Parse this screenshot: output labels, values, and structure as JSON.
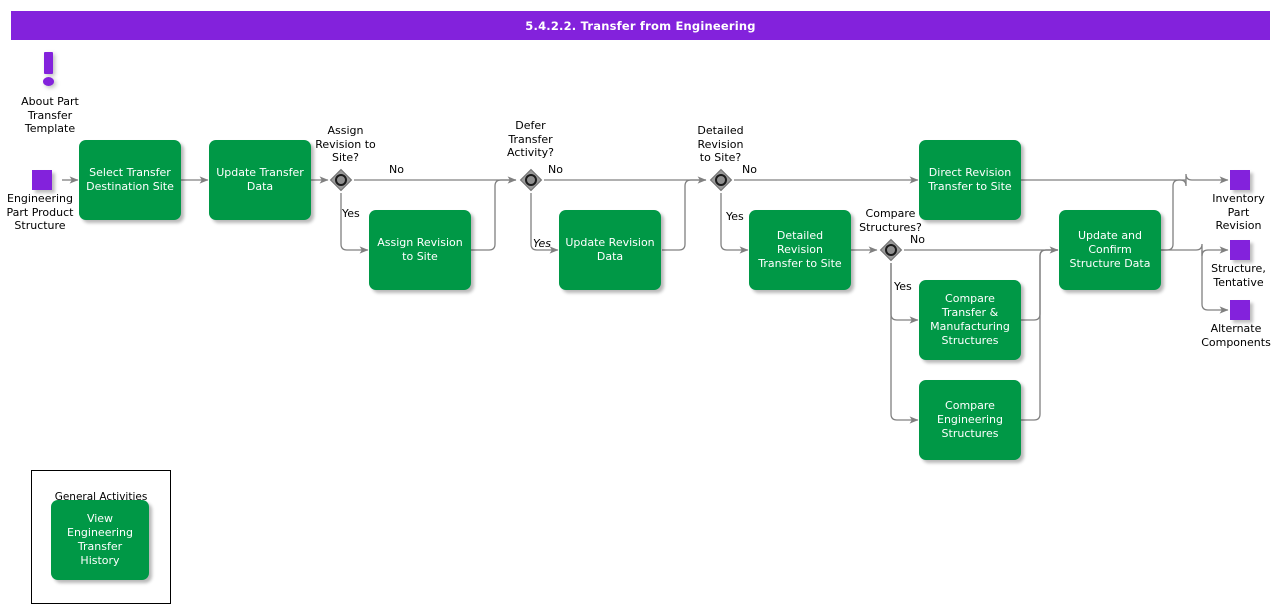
{
  "header": {
    "title": "5.4.2.2. Transfer from Engineering",
    "bar_color": "#8322dc"
  },
  "palette": {
    "task_green": "#009846",
    "node_purple": "#8322dc",
    "gateway_gray": "#999999",
    "connector_gray": "#808080",
    "text_black": "#000000",
    "task_text": "#ffffff"
  },
  "annotations": {
    "info_marker": {
      "icon": "exclamation-marker-icon",
      "label": "About Part\nTransfer\nTemplate"
    }
  },
  "start_nodes": [
    {
      "id": "engineering-part-product-structure",
      "label": "Engineering\nPart Product\nStructure"
    }
  ],
  "end_nodes": [
    {
      "id": "inventory-part-revision",
      "label": "Inventory\nPart\nRevision"
    },
    {
      "id": "structure-tentative",
      "label": "Structure,\nTentative"
    },
    {
      "id": "alternate-components",
      "label": "Alternate\nComponents"
    }
  ],
  "tasks": [
    {
      "id": "select-transfer-destination-site",
      "label": "Select Transfer\nDestination Site"
    },
    {
      "id": "update-transfer-data",
      "label": "Update Transfer\nData"
    },
    {
      "id": "assign-revision-to-site",
      "label": "Assign Revision\nto Site"
    },
    {
      "id": "update-revision-data",
      "label": "Update Revision\nData"
    },
    {
      "id": "detailed-revision-transfer-to-site",
      "label": "Detailed\nRevision\nTransfer to Site"
    },
    {
      "id": "direct-revision-transfer-to-site",
      "label": "Direct Revision\nTransfer to Site"
    },
    {
      "id": "compare-transfer-manufacturing-structures",
      "label": "Compare\nTransfer &\nManufacturing\nStructures"
    },
    {
      "id": "compare-engineering-structures",
      "label": "Compare\nEngineering\nStructures"
    },
    {
      "id": "update-and-confirm-structure-data",
      "label": "Update and\nConfirm\nStructure Data"
    }
  ],
  "gateways": [
    {
      "id": "assign-revision-to-site-gateway",
      "label": "Assign\nRevision to\nSite?",
      "branches": [
        "No",
        "Yes"
      ]
    },
    {
      "id": "defer-transfer-activity-gateway",
      "label": "Defer\nTransfer\nActivity?",
      "branches": [
        "No",
        "Yes"
      ]
    },
    {
      "id": "detailed-revision-to-site-gateway",
      "label": "Detailed\nRevision\nto Site?",
      "branches": [
        "No",
        "Yes"
      ]
    },
    {
      "id": "compare-structures-gateway",
      "label": "Compare\nStructures?",
      "branches": [
        "No",
        "Yes"
      ]
    }
  ],
  "flow_labels": {
    "g1_no": "No",
    "g1_yes": "Yes",
    "g2_no": "No",
    "g2_yes": "Yes",
    "g3_no": "No",
    "g3_yes": "Yes",
    "g4_no": "No",
    "g4_yes": "Yes"
  },
  "general_activities": {
    "title": "General Activities",
    "tasks": [
      {
        "id": "view-engineering-transfer-history",
        "label": "View\nEngineering\nTransfer History"
      }
    ]
  }
}
